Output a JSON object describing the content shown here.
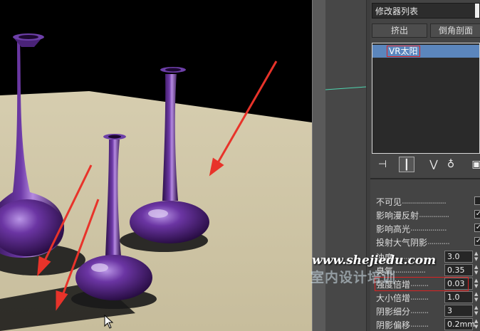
{
  "panel": {
    "modifier_list": "修改器列表",
    "buttons": [
      "挤出",
      "倒角剖面"
    ],
    "stack_item": "VR太阳",
    "toolbar_icons": [
      "pin-stack-icon",
      "show-end-result-icon",
      "make-unique-icon",
      "remove-modifier-icon",
      "configure-sets-icon"
    ]
  },
  "params": {
    "checkboxes": [
      {
        "label": "不可见",
        "checked": false
      },
      {
        "label": "影响漫反射",
        "checked": true
      },
      {
        "label": "影响高光",
        "checked": true
      },
      {
        "label": "投射大气阴影",
        "checked": true
      }
    ],
    "numbers": [
      {
        "label": "浊度",
        "value": "3.0"
      },
      {
        "label": "臭氧",
        "value": "0.35"
      },
      {
        "label": "强度倍增",
        "value": "0.03"
      },
      {
        "label": "大小倍增",
        "value": "1.0"
      },
      {
        "label": "阴影细分",
        "value": "3"
      },
      {
        "label": "阴影偏移",
        "value": "0.2mm"
      }
    ]
  },
  "watermark": {
    "url": "www.shejiedu.com",
    "text": "室内设计培训"
  },
  "colors": {
    "vase": "#5a2a8a",
    "floor": "#c9bfa0",
    "arrow": "#e8332a",
    "highlight_box": "#dd2222",
    "selection": "#5b86bd"
  }
}
